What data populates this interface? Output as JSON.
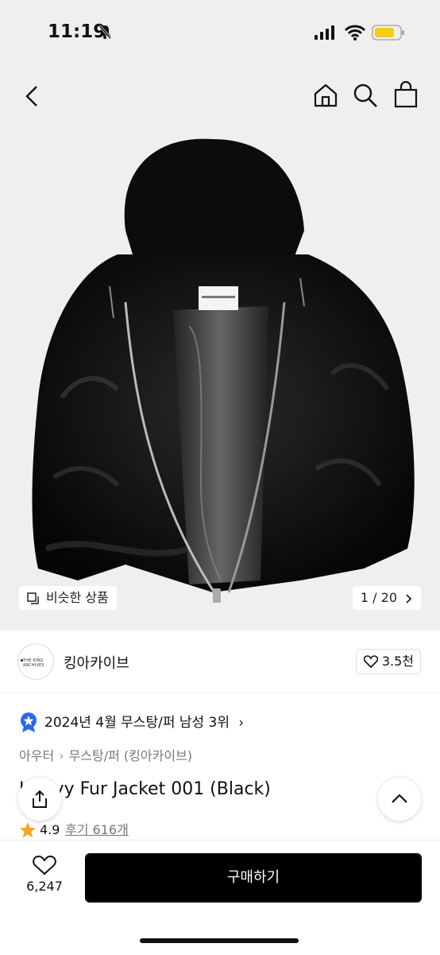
{
  "status_bar": {
    "time": "11:19"
  },
  "header": {
    "back_icon": "chevron-left-icon",
    "home_icon": "home-icon",
    "search_icon": "search-icon",
    "bag_icon": "shopping-bag-icon"
  },
  "gallery": {
    "label_text": "THE KING ARCHIVES",
    "similar_label": "비슷한 상품",
    "pager": "1 / 20"
  },
  "seller": {
    "logo_text": "THE KING ARCHIVES",
    "name": "킹아카이브",
    "likes": "3.5천"
  },
  "product": {
    "rank_badge": "2024년 4월 무스탕/퍼 남성 3위",
    "breadcrumb": [
      "아우터",
      "무스탕/퍼 (킹아카이브)"
    ],
    "title": "Heavy Fur Jacket 001 (Black)",
    "rating": "4.9",
    "reviews": "후기 616개"
  },
  "bottom_bar": {
    "wish_count": "6,247",
    "buy_label": "구매하기"
  },
  "colors": {
    "accent_star": "#f5a623",
    "medal": "#2a6ae8",
    "buy_bg": "#000000"
  }
}
